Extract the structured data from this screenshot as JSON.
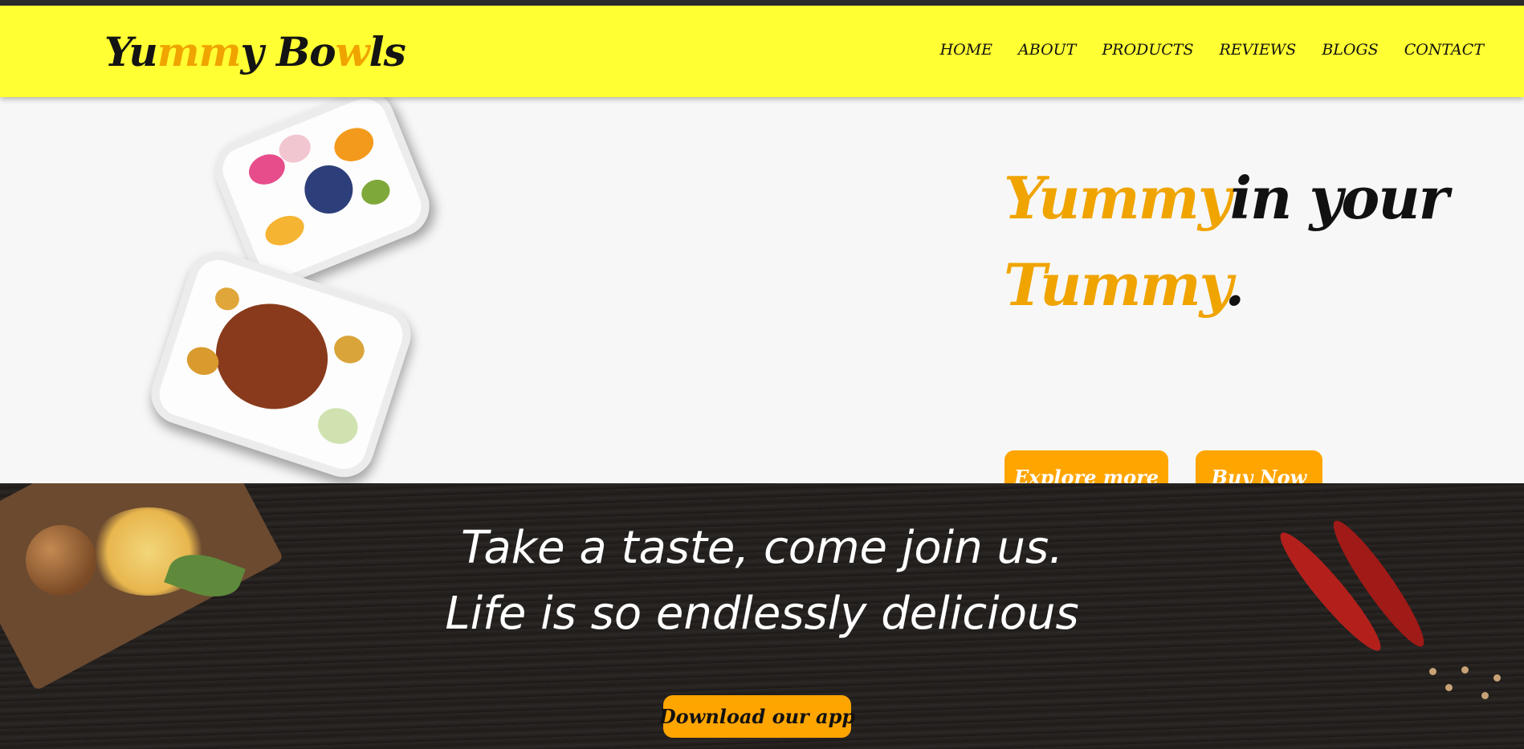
{
  "brand": {
    "logo_parts": [
      "Yu",
      "mm",
      "y Bo",
      "w",
      "ls"
    ]
  },
  "nav": {
    "items": [
      "HOME",
      "ABOUT",
      "PRODUCTS",
      "REVIEWS",
      "BLOGS",
      "CONTACT"
    ]
  },
  "hero": {
    "headline_accent_1": "Yummy",
    "headline_rest_1": "in your",
    "headline_accent_2": "Tummy",
    "headline_rest_2": ".",
    "explore_label": "Explore more",
    "buy_label": "Buy Now"
  },
  "band": {
    "line1": "Take a taste, come join us.",
    "line2": "Life is so endlessly delicious",
    "download_label": "Download our app"
  },
  "colors": {
    "nav_bg": "#ffff33",
    "accent": "#f0a400",
    "button": "#ffa500"
  }
}
